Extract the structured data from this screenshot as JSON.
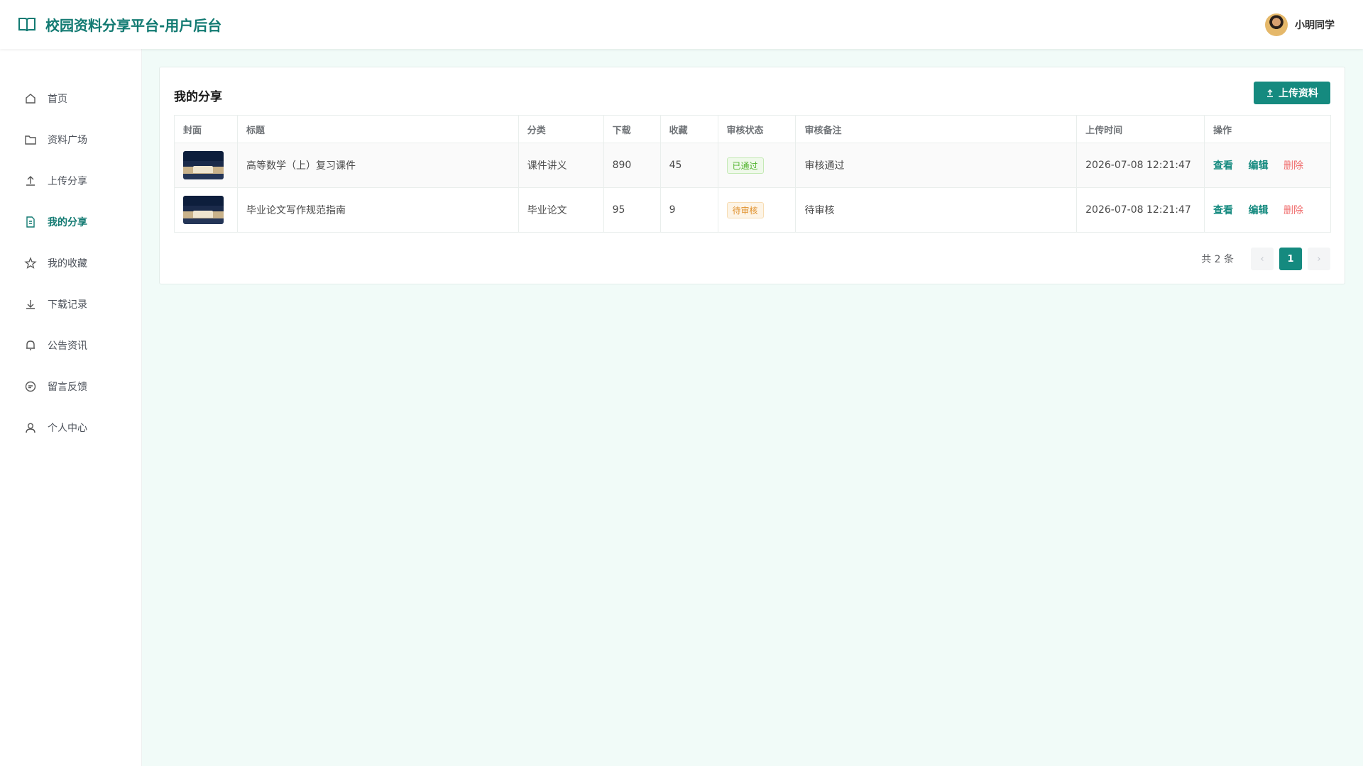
{
  "header": {
    "brand_title": "校园资料分享平台-用户后台",
    "user_name": "小明同学"
  },
  "sidebar": {
    "items": [
      {
        "label": "首页",
        "icon": "home-icon"
      },
      {
        "label": "资料广场",
        "icon": "folder-icon"
      },
      {
        "label": "上传分享",
        "icon": "upload-icon"
      },
      {
        "label": "我的分享",
        "icon": "document-icon",
        "active": true
      },
      {
        "label": "我的收藏",
        "icon": "star-icon"
      },
      {
        "label": "下载记录",
        "icon": "download-icon"
      },
      {
        "label": "公告资讯",
        "icon": "bell-icon"
      },
      {
        "label": "留言反馈",
        "icon": "message-icon"
      },
      {
        "label": "个人中心",
        "icon": "user-icon"
      }
    ]
  },
  "main": {
    "title": "我的分享",
    "upload_label": "上传资料",
    "columns": [
      "封面",
      "标题",
      "分类",
      "下载",
      "收藏",
      "审核状态",
      "审核备注",
      "上传时间",
      "操作"
    ],
    "rows": [
      {
        "title": "高等数学（上）复习课件",
        "category": "课件讲义",
        "downloads": "890",
        "favorites": "45",
        "status": "已通过",
        "status_type": "approved",
        "remark": "审核通过",
        "uploaded": "2026-07-08 12:21:47"
      },
      {
        "title": "毕业论文写作规范指南",
        "category": "毕业论文",
        "downloads": "95",
        "favorites": "9",
        "status": "待审核",
        "status_type": "pending",
        "remark": "待审核",
        "uploaded": "2026-07-08 12:21:47"
      }
    ],
    "actions": {
      "view": "查看",
      "edit": "编辑",
      "delete": "删除"
    },
    "pagination": {
      "total_text": "共 2 条",
      "current_page": "1",
      "prev": "‹",
      "next": "›"
    }
  },
  "colors": {
    "accent": "#158a7f",
    "approved": "#52b42e",
    "pending": "#e0902b",
    "delete": "#f06d6d"
  }
}
